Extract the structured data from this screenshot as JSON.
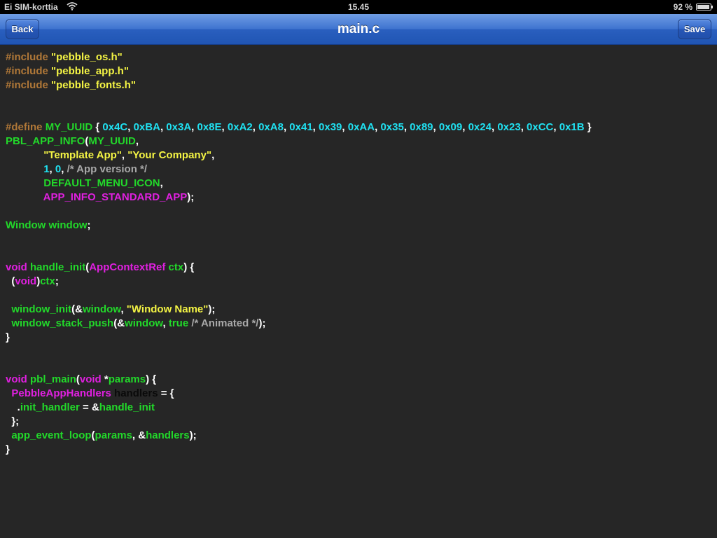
{
  "status_bar": {
    "carrier": "Ei SIM-korttia",
    "time": "15.45",
    "battery": "92 %",
    "battery_level": 0.92
  },
  "nav_bar": {
    "title": "main.c",
    "back_label": "Back",
    "save_label": "Save"
  },
  "colors": {
    "keyword": "#e020e0",
    "identifier": "#22d82a",
    "string": "#f4f444",
    "number": "#20e0f0",
    "preprocessor": "#b07838",
    "comment": "#a8a8a8",
    "punctuation": "#ffffff",
    "dark": "#0a0a0a"
  },
  "code_lines": [
    [
      {
        "t": "#include",
        "c": "preprocessor"
      },
      {
        "t": " ",
        "c": "punctuation"
      },
      {
        "t": "\"pebble_os.h\"",
        "c": "string"
      }
    ],
    [
      {
        "t": "#include",
        "c": "preprocessor"
      },
      {
        "t": " ",
        "c": "punctuation"
      },
      {
        "t": "\"pebble_app.h\"",
        "c": "string"
      }
    ],
    [
      {
        "t": "#include",
        "c": "preprocessor"
      },
      {
        "t": " ",
        "c": "punctuation"
      },
      {
        "t": "\"pebble_fonts.h\"",
        "c": "string"
      }
    ],
    [],
    [],
    [
      {
        "t": "#define",
        "c": "preprocessor"
      },
      {
        "t": " ",
        "c": "punctuation"
      },
      {
        "t": "MY_UUID",
        "c": "identifier"
      },
      {
        "t": " { ",
        "c": "punctuation"
      },
      {
        "t": "0x4C",
        "c": "number"
      },
      {
        "t": ", ",
        "c": "punctuation"
      },
      {
        "t": "0xBA",
        "c": "number"
      },
      {
        "t": ", ",
        "c": "punctuation"
      },
      {
        "t": "0x3A",
        "c": "number"
      },
      {
        "t": ", ",
        "c": "punctuation"
      },
      {
        "t": "0x8E",
        "c": "number"
      },
      {
        "t": ", ",
        "c": "punctuation"
      },
      {
        "t": "0xA2",
        "c": "number"
      },
      {
        "t": ", ",
        "c": "punctuation"
      },
      {
        "t": "0xA8",
        "c": "number"
      },
      {
        "t": ", ",
        "c": "punctuation"
      },
      {
        "t": "0x41",
        "c": "number"
      },
      {
        "t": ", ",
        "c": "punctuation"
      },
      {
        "t": "0x39",
        "c": "number"
      },
      {
        "t": ", ",
        "c": "punctuation"
      },
      {
        "t": "0xAA",
        "c": "number"
      },
      {
        "t": ", ",
        "c": "punctuation"
      },
      {
        "t": "0x35",
        "c": "number"
      },
      {
        "t": ", ",
        "c": "punctuation"
      },
      {
        "t": "0x89",
        "c": "number"
      },
      {
        "t": ", ",
        "c": "punctuation"
      },
      {
        "t": "0x09",
        "c": "number"
      },
      {
        "t": ", ",
        "c": "punctuation"
      },
      {
        "t": "0x24",
        "c": "number"
      },
      {
        "t": ", ",
        "c": "punctuation"
      },
      {
        "t": "0x23",
        "c": "number"
      },
      {
        "t": ", ",
        "c": "punctuation"
      },
      {
        "t": "0xCC",
        "c": "number"
      },
      {
        "t": ", ",
        "c": "punctuation"
      },
      {
        "t": "0x1B",
        "c": "number"
      },
      {
        "t": " }",
        "c": "punctuation"
      }
    ],
    [
      {
        "t": "PBL_APP_INFO",
        "c": "identifier"
      },
      {
        "t": "(",
        "c": "punctuation"
      },
      {
        "t": "MY_UUID",
        "c": "identifier"
      },
      {
        "t": ",",
        "c": "punctuation"
      }
    ],
    [
      {
        "t": "             ",
        "c": "punctuation"
      },
      {
        "t": "\"Template App\"",
        "c": "string"
      },
      {
        "t": ", ",
        "c": "punctuation"
      },
      {
        "t": "\"Your Company\"",
        "c": "string"
      },
      {
        "t": ",",
        "c": "punctuation"
      }
    ],
    [
      {
        "t": "             ",
        "c": "punctuation"
      },
      {
        "t": "1",
        "c": "number"
      },
      {
        "t": ", ",
        "c": "punctuation"
      },
      {
        "t": "0",
        "c": "number"
      },
      {
        "t": ", ",
        "c": "punctuation"
      },
      {
        "t": "/* App version */",
        "c": "comment"
      }
    ],
    [
      {
        "t": "             ",
        "c": "punctuation"
      },
      {
        "t": "DEFAULT_MENU_ICON",
        "c": "identifier"
      },
      {
        "t": ",",
        "c": "punctuation"
      }
    ],
    [
      {
        "t": "             ",
        "c": "punctuation"
      },
      {
        "t": "APP_INFO_STANDARD_APP",
        "c": "keyword"
      },
      {
        "t": ");",
        "c": "punctuation"
      }
    ],
    [],
    [
      {
        "t": "Window",
        "c": "identifier"
      },
      {
        "t": " ",
        "c": "punctuation"
      },
      {
        "t": "window",
        "c": "identifier"
      },
      {
        "t": ";",
        "c": "punctuation"
      }
    ],
    [],
    [],
    [
      {
        "t": "void",
        "c": "keyword"
      },
      {
        "t": " ",
        "c": "punctuation"
      },
      {
        "t": "handle_init",
        "c": "identifier"
      },
      {
        "t": "(",
        "c": "punctuation"
      },
      {
        "t": "AppContextRef",
        "c": "keyword"
      },
      {
        "t": " ",
        "c": "punctuation"
      },
      {
        "t": "ctx",
        "c": "identifier"
      },
      {
        "t": ") {",
        "c": "punctuation"
      }
    ],
    [
      {
        "t": "  (",
        "c": "punctuation"
      },
      {
        "t": "void",
        "c": "keyword"
      },
      {
        "t": ")",
        "c": "punctuation"
      },
      {
        "t": "ctx",
        "c": "identifier"
      },
      {
        "t": ";",
        "c": "punctuation"
      }
    ],
    [],
    [
      {
        "t": "  ",
        "c": "punctuation"
      },
      {
        "t": "window_init",
        "c": "identifier"
      },
      {
        "t": "(&",
        "c": "punctuation"
      },
      {
        "t": "window",
        "c": "identifier"
      },
      {
        "t": ", ",
        "c": "punctuation"
      },
      {
        "t": "\"Window Name\"",
        "c": "string"
      },
      {
        "t": ");",
        "c": "punctuation"
      }
    ],
    [
      {
        "t": "  ",
        "c": "punctuation"
      },
      {
        "t": "window_stack_push",
        "c": "identifier"
      },
      {
        "t": "(&",
        "c": "punctuation"
      },
      {
        "t": "window",
        "c": "identifier"
      },
      {
        "t": ", ",
        "c": "punctuation"
      },
      {
        "t": "true",
        "c": "identifier"
      },
      {
        "t": " ",
        "c": "punctuation"
      },
      {
        "t": "/* Animated */",
        "c": "comment"
      },
      {
        "t": ");",
        "c": "punctuation"
      }
    ],
    [
      {
        "t": "}",
        "c": "punctuation"
      }
    ],
    [],
    [],
    [
      {
        "t": "void",
        "c": "keyword"
      },
      {
        "t": " ",
        "c": "punctuation"
      },
      {
        "t": "pbl_main",
        "c": "identifier"
      },
      {
        "t": "(",
        "c": "punctuation"
      },
      {
        "t": "void",
        "c": "keyword"
      },
      {
        "t": " *",
        "c": "punctuation"
      },
      {
        "t": "params",
        "c": "identifier"
      },
      {
        "t": ") {",
        "c": "punctuation"
      }
    ],
    [
      {
        "t": "  ",
        "c": "punctuation"
      },
      {
        "t": "PebbleAppHandlers",
        "c": "keyword"
      },
      {
        "t": " ",
        "c": "punctuation"
      },
      {
        "t": "handlers",
        "c": "dark"
      },
      {
        "t": " = {",
        "c": "punctuation"
      }
    ],
    [
      {
        "t": "    .",
        "c": "punctuation"
      },
      {
        "t": "init_handler",
        "c": "identifier"
      },
      {
        "t": " = &",
        "c": "punctuation"
      },
      {
        "t": "handle_init",
        "c": "identifier"
      }
    ],
    [
      {
        "t": "  };",
        "c": "punctuation"
      }
    ],
    [
      {
        "t": "  ",
        "c": "punctuation"
      },
      {
        "t": "app_event_loop",
        "c": "identifier"
      },
      {
        "t": "(",
        "c": "punctuation"
      },
      {
        "t": "params",
        "c": "identifier"
      },
      {
        "t": ", &",
        "c": "punctuation"
      },
      {
        "t": "handlers",
        "c": "identifier"
      },
      {
        "t": ");",
        "c": "punctuation"
      }
    ],
    [
      {
        "t": "}",
        "c": "punctuation"
      }
    ]
  ]
}
